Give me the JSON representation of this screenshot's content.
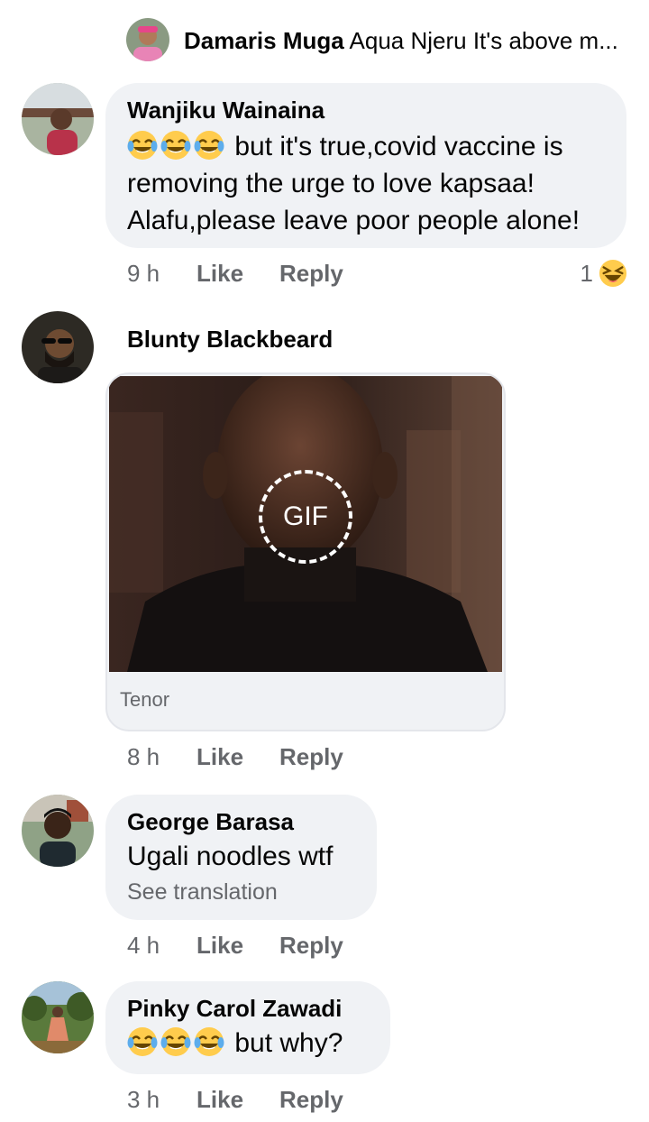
{
  "reply_preview": {
    "author": "Damaris Muga",
    "text": "Aqua Njeru It's above m..."
  },
  "comments": [
    {
      "author": "Wanjiku Wainaina",
      "emojis": [
        "tears-of-joy",
        "tears-of-joy",
        "tears-of-joy"
      ],
      "text_line1": "but it's true,covid vaccine is",
      "text_line2": "removing the urge to love kapsaa!",
      "text_line3": "Alafu,please leave poor people alone!",
      "time": "9 h",
      "like": "Like",
      "reply": "Reply",
      "reaction_count": "1",
      "reaction_icon": "laughing-squint"
    },
    {
      "author": "Blunty Blackbeard",
      "gif_label": "GIF",
      "gif_source": "Tenor",
      "time": "8 h",
      "like": "Like",
      "reply": "Reply"
    },
    {
      "author": "George Barasa",
      "text": "Ugali noodles wtf",
      "see_translation": "See translation",
      "time": "4 h",
      "like": "Like",
      "reply": "Reply"
    },
    {
      "author": "Pinky Carol Zawadi",
      "emojis": [
        "tears-of-joy",
        "tears-of-joy",
        "tears-of-joy"
      ],
      "text": "but why?",
      "time": "3 h",
      "like": "Like",
      "reply": "Reply"
    }
  ],
  "colors": {
    "bubble": "#f0f2f5",
    "meta": "#65676b",
    "text": "#050505"
  }
}
